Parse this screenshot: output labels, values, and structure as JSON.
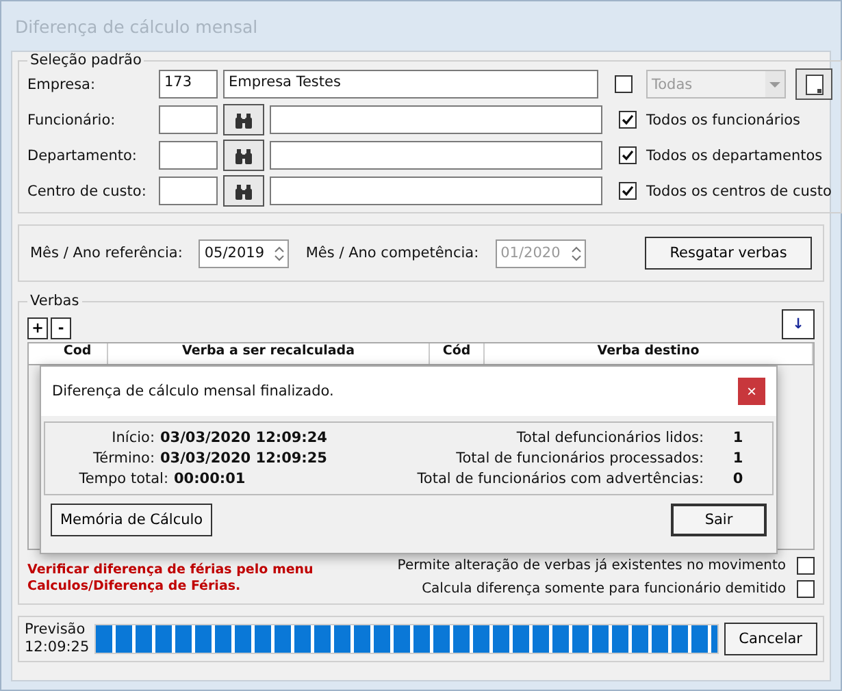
{
  "window": {
    "title": "Diferença de cálculo mensal"
  },
  "selection": {
    "legend": "Seleção padrão",
    "company": {
      "label": "Empresa:",
      "code": "173",
      "name": "Empresa Testes",
      "all_checked": false,
      "combo": "Todas"
    },
    "rows": [
      {
        "label": "Funcionário:",
        "check_label": "Todos os funcionários",
        "checked": true
      },
      {
        "label": "Departamento:",
        "check_label": "Todos os departamentos",
        "checked": true
      },
      {
        "label": "Centro de custo:",
        "check_label": "Todos os centros de custo",
        "checked": true
      }
    ]
  },
  "period": {
    "reference_label": "Mês / Ano referência:",
    "reference": "05/2019",
    "competence_label": "Mês / Ano competência:",
    "competence": "01/2020",
    "button": "Resgatar verbas"
  },
  "verbas": {
    "legend": "Verbas",
    "add": "+",
    "remove": "-",
    "down": "↓",
    "columns": [
      "Cod",
      "Verba a ser recalculada",
      "Cód",
      "Verba destino"
    ],
    "note": "Verificar diferença de férias pelo menu Calculos/Diferença de Férias.",
    "options": [
      {
        "label": "Permite alteração de verbas já existentes no movimento",
        "checked": false
      },
      {
        "label": "Calcula diferença somente para funcionário demitido",
        "checked": false
      }
    ]
  },
  "status": {
    "forecast_label": "Previsão",
    "forecast_time": "12:09:25",
    "level": 1,
    "cancel": "Cancelar"
  },
  "dialog": {
    "title": "Diferença de cálculo mensal finalizado.",
    "close": "×",
    "left": [
      {
        "label": "Início:",
        "value": "03/03/2020 12:09:24"
      },
      {
        "label": "Término:",
        "value": "03/03/2020 12:09:25"
      },
      {
        "label": "Tempo total:",
        "value": "00:00:01"
      }
    ],
    "right": [
      {
        "label": "Total defuncionários lidos:",
        "value": "1"
      },
      {
        "label": "Total de funcionários processados:",
        "value": "1"
      },
      {
        "label": "Total de funcionários com advertências:",
        "value": "0"
      }
    ],
    "buttons": [
      "Memória de Cálculo",
      "Sair"
    ]
  }
}
